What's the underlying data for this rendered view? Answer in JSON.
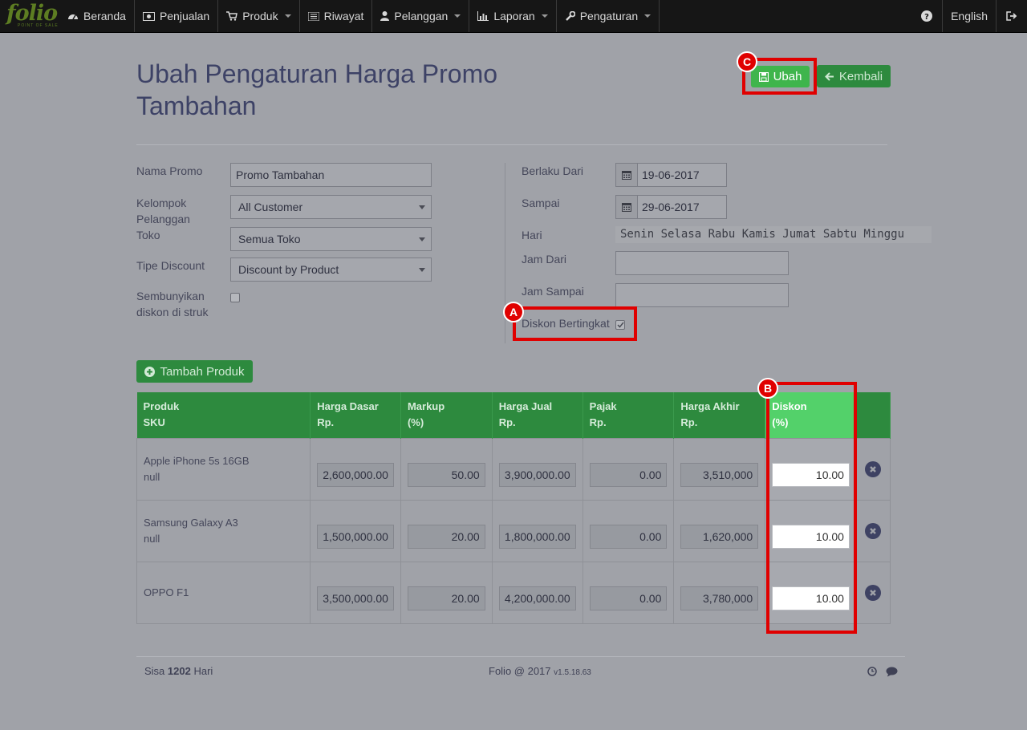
{
  "app": {
    "logo": "folio",
    "logo_tagline": "POINT OF SALE"
  },
  "nav": {
    "items": [
      {
        "label": "Beranda",
        "icon": "dashboard-icon"
      },
      {
        "label": "Penjualan",
        "icon": "cash-icon"
      },
      {
        "label": "Produk",
        "icon": "cart-icon"
      },
      {
        "label": "Riwayat",
        "icon": "list-icon"
      },
      {
        "label": "Pelanggan",
        "icon": "user-icon"
      },
      {
        "label": "Laporan",
        "icon": "bar-chart-icon"
      },
      {
        "label": "Pengaturan",
        "icon": "wrench-icon"
      }
    ],
    "help_icon": "question-circle-icon",
    "language": "English",
    "logout_icon": "sign-out-icon"
  },
  "page": {
    "title": "Ubah Pengaturan Harga Promo Tambahan",
    "save_label": "Ubah",
    "back_label": "Kembali"
  },
  "form": {
    "nama_promo_label": "Nama Promo",
    "nama_promo_value": "Promo Tambahan",
    "kelompok_label": "Kelompok Pelanggan",
    "kelompok_value": "All Customer",
    "toko_label": "Toko",
    "toko_value": "Semua Toko",
    "tipe_label": "Tipe Discount",
    "tipe_value": "Discount by Product",
    "sembunyikan_label": "Sembunyikan diskon di struk",
    "berlaku_label": "Berlaku Dari",
    "berlaku_value": "19-06-2017",
    "sampai_label": "Sampai",
    "sampai_value": "29-06-2017",
    "hari_label": "Hari",
    "hari_value": "Senin Selasa Rabu Kamis Jumat Sabtu Minggu",
    "jam_dari_label": "Jam Dari",
    "jam_sampai_label": "Jam Sampai",
    "diskon_bertingkat_label": "Diskon Bertingkat"
  },
  "add_product_label": "Tambah Produk",
  "table": {
    "headers": [
      [
        "Produk",
        "SKU"
      ],
      [
        "Harga Dasar",
        "Rp."
      ],
      [
        "Markup",
        "(%)"
      ],
      [
        "Harga Jual",
        "Rp."
      ],
      [
        "Pajak",
        "Rp."
      ],
      [
        "Harga Akhir",
        "Rp."
      ],
      [
        "Diskon",
        "(%)"
      ]
    ],
    "rows": [
      {
        "name": "Apple iPhone 5s 16GB",
        "sku": "null",
        "harga_dasar": "2,600,000.00",
        "markup": "50.00",
        "harga_jual": "3,900,000.00",
        "pajak": "0.00",
        "harga_akhir": "3,510,000",
        "diskon": "10.00"
      },
      {
        "name": "Samsung Galaxy A3",
        "sku": "null",
        "harga_dasar": "1,500,000.00",
        "markup": "20.00",
        "harga_jual": "1,800,000.00",
        "pajak": "0.00",
        "harga_akhir": "1,620,000",
        "diskon": "10.00"
      },
      {
        "name": "OPPO F1",
        "sku": "",
        "harga_dasar": "3,500,000.00",
        "markup": "20.00",
        "harga_jual": "4,200,000.00",
        "pajak": "0.00",
        "harga_akhir": "3,780,000",
        "diskon": "10.00"
      }
    ]
  },
  "markers": {
    "a": "A",
    "b": "B",
    "c": "C"
  },
  "footer": {
    "sisa_prefix": "Sisa",
    "sisa_days": "1202",
    "sisa_suffix": "Hari",
    "copyright": "Folio @ 2017",
    "version": "v1.5.18.63"
  },
  "colors": {
    "accent": "#3fb54c",
    "highlight": "#e00000",
    "header": "#2d8a3e"
  }
}
